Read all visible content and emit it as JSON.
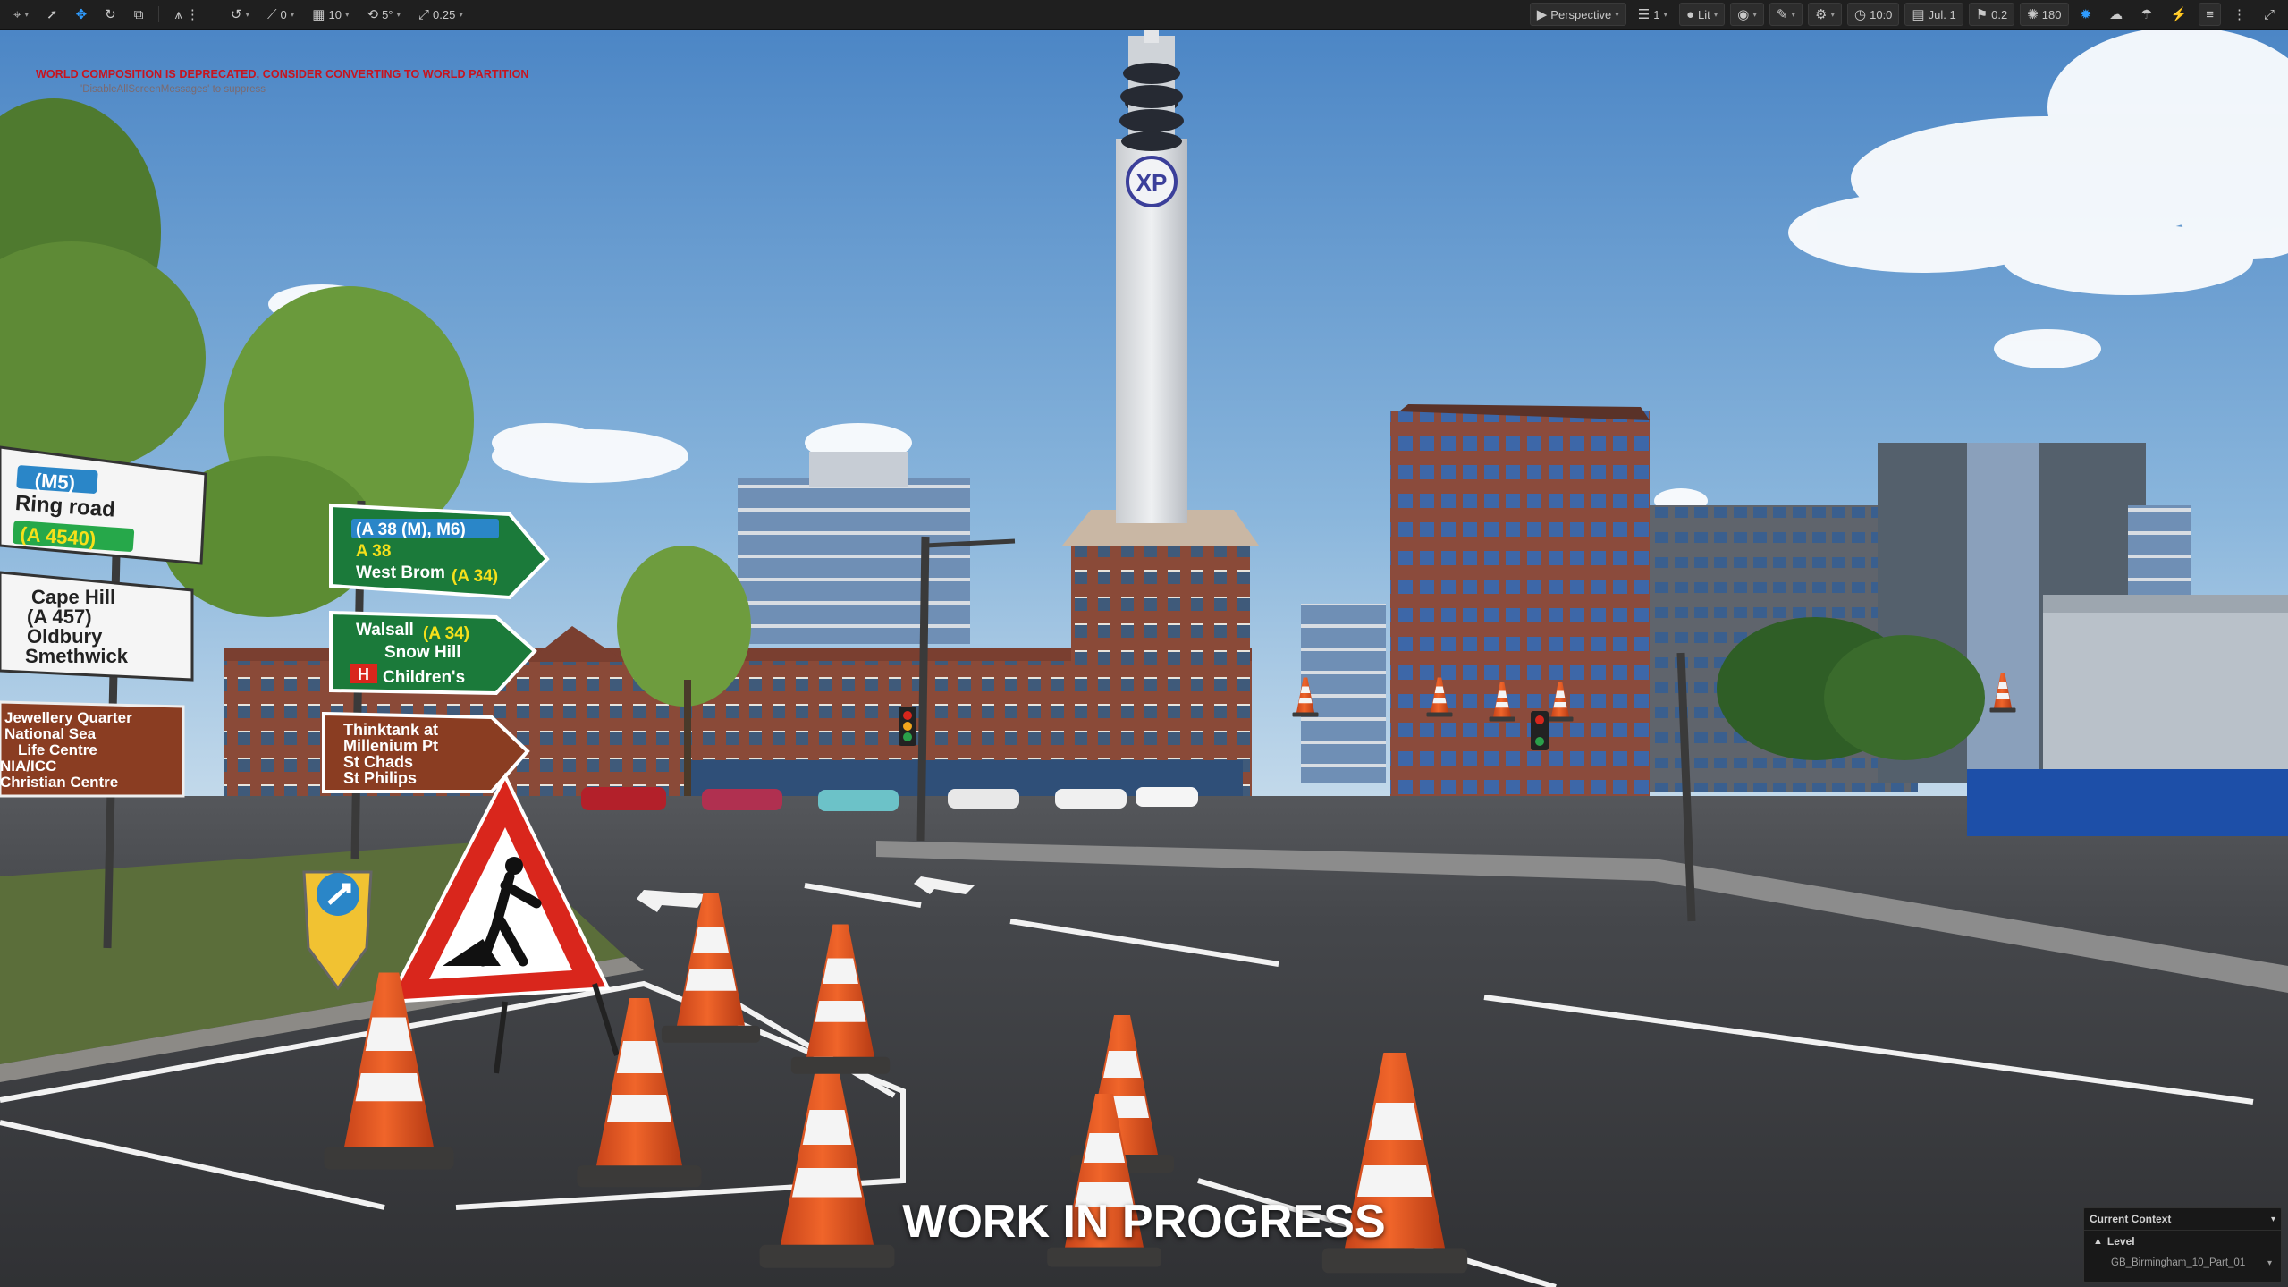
{
  "toolbar": {
    "left": {
      "snap_rotation": "0",
      "snap_grid": "10",
      "snap_angle": "5°",
      "camera_speed": "0.25"
    },
    "right": {
      "view_mode": "Perspective",
      "viewport_layout": "1",
      "lighting_mode": "Lit",
      "time": "10:0",
      "date": "Jul. 1",
      "cloud": "0.2",
      "sun": "180"
    }
  },
  "messages": {
    "warning": "WORLD COMPOSITION IS DEPRECATED, CONSIDER CONVERTING TO WORLD PARTITION",
    "hint": "'DisableAllScreenMessages' to suppress"
  },
  "overlay_title": "WORK IN PROGRESS",
  "context_panel": {
    "title": "Current Context",
    "level_label": "Level",
    "map_name": "GB_Birmingham_10_Part_01"
  },
  "scene": {
    "tower_logo": "XP",
    "signs": {
      "ring_road": {
        "route": "(M5)",
        "label": "Ring road",
        "road": "(A 4540)"
      },
      "cape_hill": {
        "lines": [
          "Cape Hill",
          "(A 457)",
          "Oldbury",
          "Smethwick"
        ]
      },
      "jewellery": {
        "lines": [
          "Jewellery Quarter",
          "National Sea",
          "Life Centre",
          "NIA/ICC",
          "Christian Centre"
        ]
      },
      "green_1": {
        "top": "(A 38 (M), M6)",
        "line2": "A 38",
        "line3": "West Brom",
        "line3_road": "(A 34)"
      },
      "green_2": {
        "line1": "Walsall",
        "line1_road": "(A 34)",
        "line2": "Snow Hill",
        "hospital": "H",
        "line3": "Children's"
      },
      "brown": {
        "lines": [
          "Thinktank at",
          "Millenium Pt",
          "St Chads",
          "St Philips"
        ]
      }
    }
  },
  "colors": {
    "toolbar_bg": "#1f1f1f",
    "accent": "#2f9cff",
    "warning": "#c8141e",
    "sky_top": "#4a86c6",
    "sky_bottom": "#c6dcec",
    "road": "#3b3c3f"
  }
}
